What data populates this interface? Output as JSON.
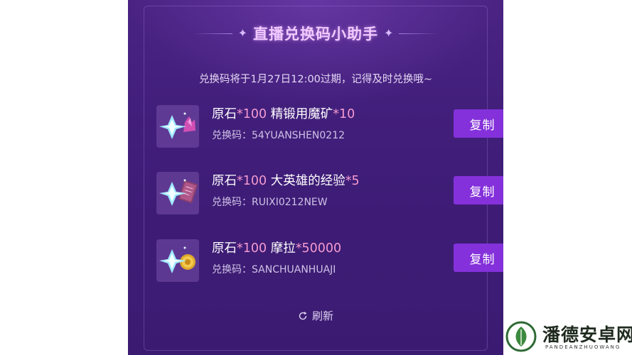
{
  "panel": {
    "title": "直播兑换码小助手",
    "notice": "兑换码将于1月27日12:00过期，记得及时兑换哦~"
  },
  "items": [
    {
      "icon": "primogem-and-ore-icon",
      "name_part1": "原石",
      "qty1": "*100",
      "name_part2": " 精锻用魔矿",
      "qty2": "*10",
      "code_label": "兑换码：",
      "code": "54YUANSHEN0212",
      "copy_label": "复制"
    },
    {
      "icon": "primogem-and-book-icon",
      "name_part1": "原石",
      "qty1": "*100",
      "name_part2": " 大英雄的经验",
      "qty2": "*5",
      "code_label": "兑换码：",
      "code": "RUIXI0212NEW",
      "copy_label": "复制"
    },
    {
      "icon": "primogem-and-mora-icon",
      "name_part1": "原石",
      "qty1": "*100",
      "name_part2": " 摩拉",
      "qty2": "*50000",
      "code_label": "兑换码：",
      "code": "SANCHUANHUAJI",
      "copy_label": "复制"
    }
  ],
  "refresh_label": "刷新",
  "watermark": {
    "title": "潘德安卓网",
    "subtitle": "PANDEANZHUOWANG"
  },
  "colors": {
    "panel_bg": "#3f1d78",
    "button": "#8431db",
    "accent": "#f59ad0",
    "title": "#f1c9ff"
  }
}
